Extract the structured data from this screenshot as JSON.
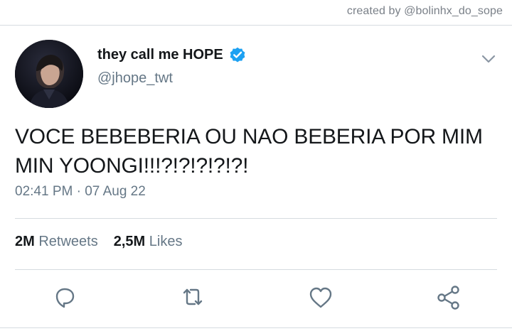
{
  "credit": "created by @bolinhx_do_sope",
  "author": {
    "display_name": "they call me HOPE",
    "handle": "@jhope_twt",
    "verified": true,
    "avatar_icon": "profile-photo"
  },
  "tweet": {
    "text_line1": "VOCE BEBEBERIA OU NAO BEBERIA POR MIM",
    "text_line2": "MIN YOONGI!!!?!?!?!?!?!",
    "time": "02:41 PM",
    "separator": "·",
    "date": "07 Aug 22"
  },
  "stats": {
    "retweets_count": "2M",
    "retweets_label": "Retweets",
    "likes_count": "2,5M",
    "likes_label": "Likes"
  },
  "actions": {
    "reply_icon": "reply-icon",
    "retweet_icon": "retweet-icon",
    "like_icon": "heart-icon",
    "share_icon": "share-icon"
  },
  "colors": {
    "text": "#14171a",
    "secondary": "#657786",
    "verified": "#1da1f2",
    "divider": "#d6dbe0"
  }
}
